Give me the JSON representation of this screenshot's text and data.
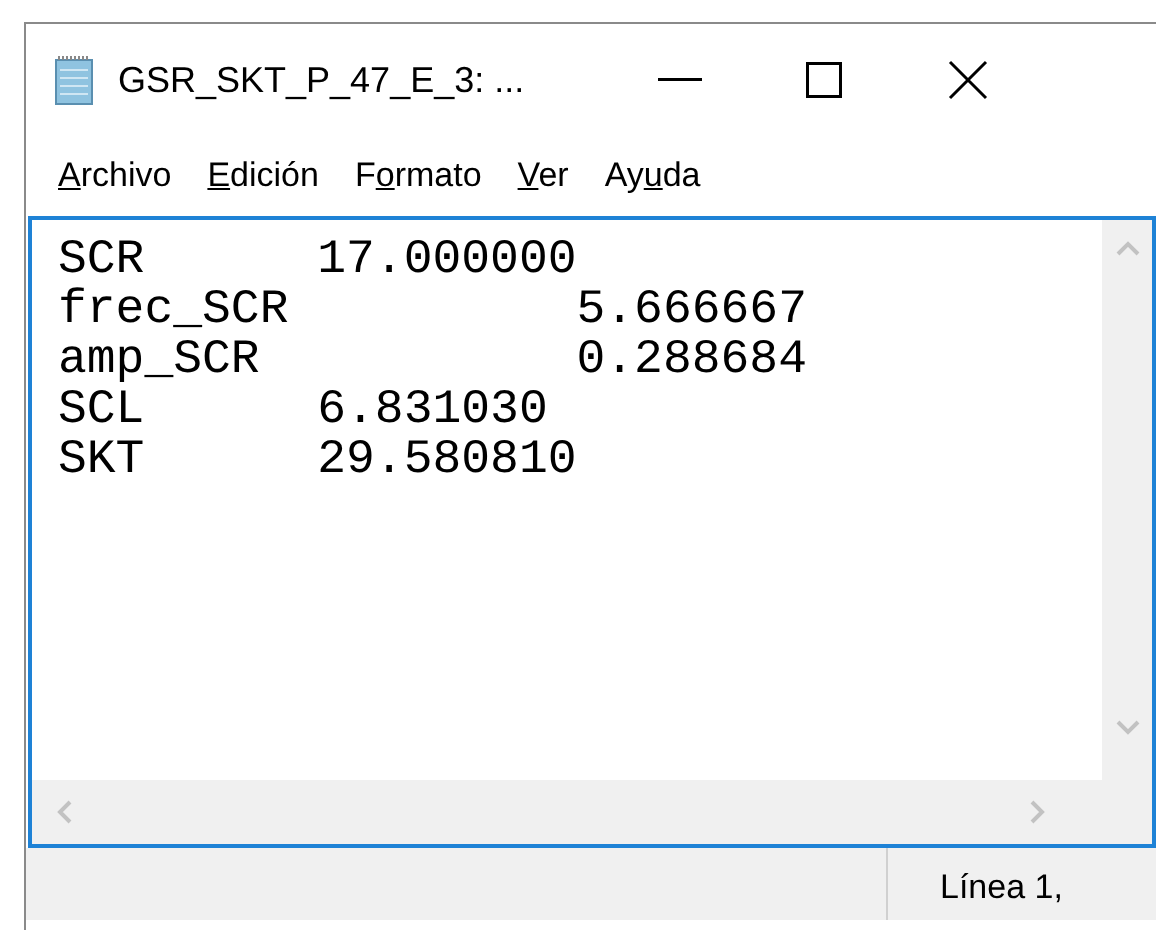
{
  "window": {
    "title": "GSR_SKT_P_47_E_3: ..."
  },
  "menu": [
    {
      "key": "A",
      "post": "rchivo"
    },
    {
      "key": "E",
      "post": "dición"
    },
    {
      "pre": "F",
      "key": "o",
      "post": "rmato"
    },
    {
      "key": "V",
      "post": "er"
    },
    {
      "pre": "Ay",
      "key": "u",
      "post": "da"
    }
  ],
  "editor": {
    "lines": [
      "SCR\t17.000000",
      "frec_SCR\t\t5.666667",
      "amp_SCR\t\t0.288684",
      "SCL\t6.831030",
      "SKT\t29.580810"
    ]
  },
  "status_bar": {
    "position": "Línea 1,"
  }
}
